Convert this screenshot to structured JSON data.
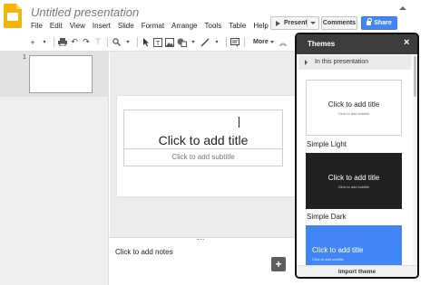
{
  "header": {
    "doc_title": "Untitled presentation",
    "menu": [
      "File",
      "Edit",
      "View",
      "Insert",
      "Slide",
      "Format",
      "Arrange",
      "Tools",
      "Table",
      "Help"
    ],
    "present_label": "Present",
    "comments_label": "Comments",
    "share_label": "Share"
  },
  "toolbar": {
    "more_label": "More"
  },
  "filmstrip": {
    "slide_number": "1"
  },
  "slide": {
    "title_placeholder": "Click to add title",
    "subtitle_placeholder": "Click to add subtitle"
  },
  "notes": {
    "placeholder": "Click to add notes"
  },
  "themes_panel": {
    "title": "Themes",
    "section_label": "In this presentation",
    "themes": [
      {
        "name": "Simple Light",
        "card_title": "Click to add title",
        "card_subtitle": "Click to add subtitle",
        "bg": "#ffffff",
        "fg": "#222222"
      },
      {
        "name": "Simple Dark",
        "card_title": "Click to add title",
        "card_subtitle": "Click to add subtitle",
        "bg": "#212121",
        "fg": "#ffffff"
      },
      {
        "name": "",
        "card_title": "Click to add title",
        "card_subtitle": "Click to add subtitle",
        "bg": "#4285f4",
        "fg": "#ffffff"
      }
    ],
    "import_label": "Import theme"
  },
  "colors": {
    "accent": "#4285f4",
    "logo": "#f4b400",
    "panel_header": "#3c3c3c"
  }
}
